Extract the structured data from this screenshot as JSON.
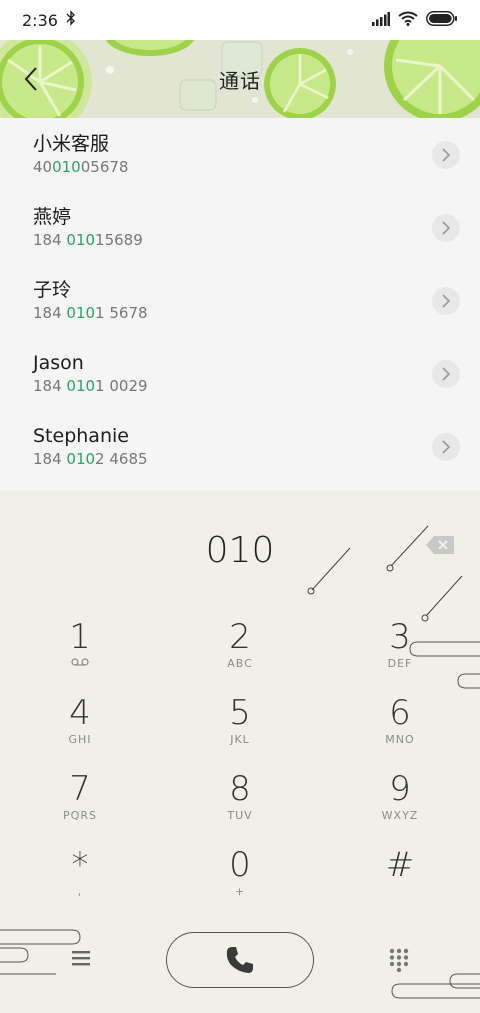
{
  "status": {
    "time": "2:36"
  },
  "header": {
    "title": "通话"
  },
  "contacts": [
    {
      "name": "小米客服",
      "num_pre": "40",
      "num_hl": "010",
      "num_post": "05678"
    },
    {
      "name": "燕婷",
      "num_pre": "184 ",
      "num_hl": "010",
      "num_post": "15689"
    },
    {
      "name": "子玲",
      "num_pre": "184 ",
      "num_hl": "010",
      "num_post": "1 5678"
    },
    {
      "name": "Jason",
      "num_pre": "184 ",
      "num_hl": "010",
      "num_post": "1 0029"
    },
    {
      "name": "Stephanie",
      "num_pre": "184 ",
      "num_hl": "010",
      "num_post": "2 4685"
    }
  ],
  "dialer": {
    "number": "010",
    "keys": [
      {
        "digit": "1",
        "letters": ""
      },
      {
        "digit": "2",
        "letters": "ABC"
      },
      {
        "digit": "3",
        "letters": "DEF"
      },
      {
        "digit": "4",
        "letters": "GHI"
      },
      {
        "digit": "5",
        "letters": "JKL"
      },
      {
        "digit": "6",
        "letters": "MNO"
      },
      {
        "digit": "7",
        "letters": "PQRS"
      },
      {
        "digit": "8",
        "letters": "TUV"
      },
      {
        "digit": "9",
        "letters": "WXYZ"
      },
      {
        "digit": "*",
        "letters": ","
      },
      {
        "digit": "0",
        "letters": "+"
      },
      {
        "digit": "#",
        "letters": ""
      }
    ]
  },
  "colors": {
    "highlight": "#2aa36b",
    "lime": "#8fcf3a",
    "background": "#f1f0e8"
  },
  "icons": {
    "back": "chevron-left-icon",
    "backspace": "backspace-icon",
    "voicemail": "voicemail-icon",
    "menu": "menu-icon",
    "call": "phone-icon",
    "dialpad": "dialpad-icon"
  }
}
